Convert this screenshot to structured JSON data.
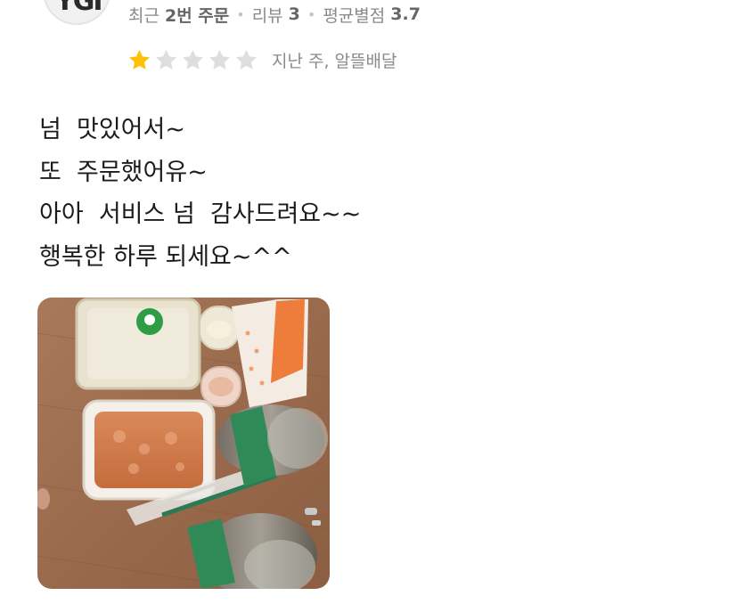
{
  "reviewer": {
    "avatar_icon": "user-avatar",
    "avatar_mark": "YGI",
    "meta": {
      "recent_label": "최근",
      "orders_value": "2번 주문",
      "reviews_label": "리뷰",
      "reviews_value": "3",
      "avg_label": "평균별점",
      "avg_value": "3.7"
    }
  },
  "rating": {
    "stars": 1,
    "max_stars": 5,
    "filled_color": "#FFC107",
    "empty_color": "#DEDEDE",
    "date_platform": "지난 주, 알뜰배달"
  },
  "review": {
    "lines": [
      "넘  맛있어서~",
      "또  주문했어유~",
      "아아  서비스 넘  감사드려요~~",
      "행복한 하루 되세요~^^"
    ]
  },
  "photo": {
    "description_icon": "food-photo"
  }
}
